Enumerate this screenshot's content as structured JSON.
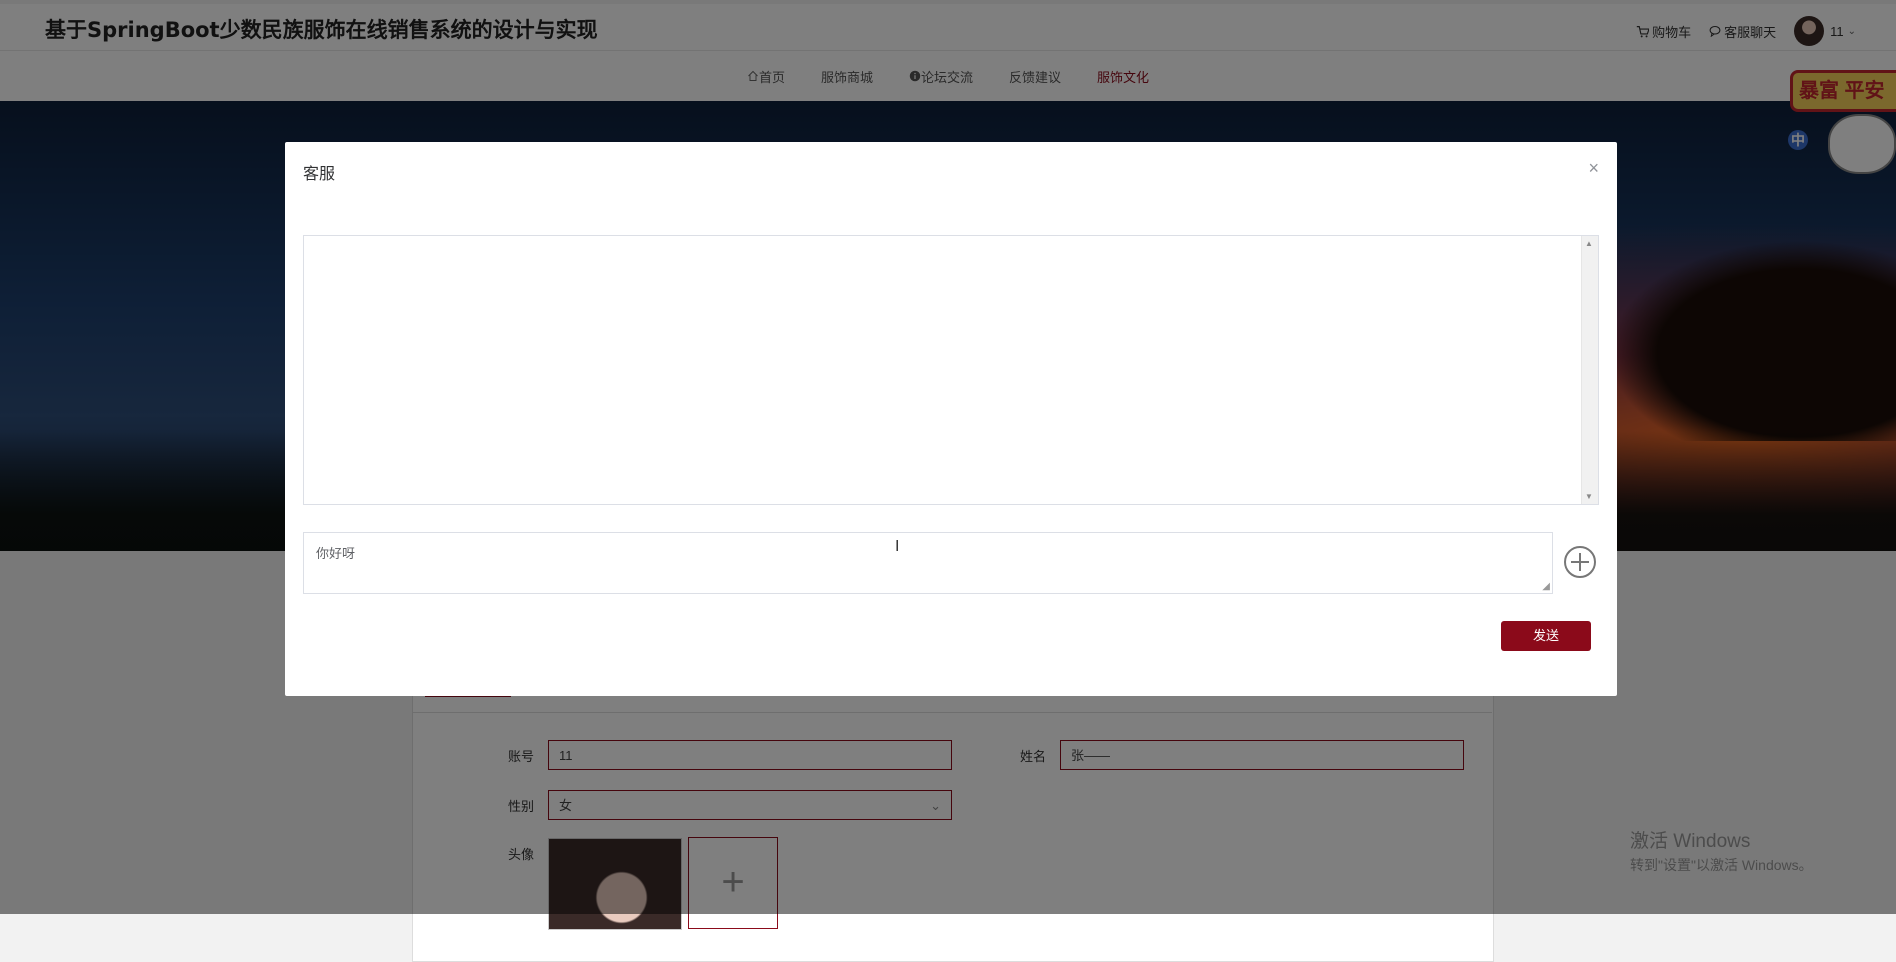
{
  "site": {
    "title": "基于SpringBoot少数民族服饰在线销售系统的设计与实现"
  },
  "top_links": {
    "cart": "购物车",
    "service_chat": "客服聊天",
    "user": "11"
  },
  "nav": [
    "首页",
    "服饰商城",
    "论坛交流",
    "反馈建议",
    "服饰文化"
  ],
  "nav_active_index": 4,
  "sticker": {
    "text": "暴富 平安",
    "badge": "中"
  },
  "dialog": {
    "title": "客服",
    "message_value": "你好呀",
    "send_label": "发送"
  },
  "profile_form": {
    "account_label": "账号",
    "account_value": "11",
    "name_label": "姓名",
    "name_value": "张——",
    "gender_label": "性别",
    "gender_value": "女",
    "avatar_label": "头像",
    "upload_symbol": "+"
  },
  "watermark": {
    "line1": "激活 Windows",
    "line2": "转到\"设置\"以激活 Windows。"
  },
  "colors": {
    "accent": "#8b0a1a",
    "overlay": "rgba(0,0,0,0.5)"
  }
}
